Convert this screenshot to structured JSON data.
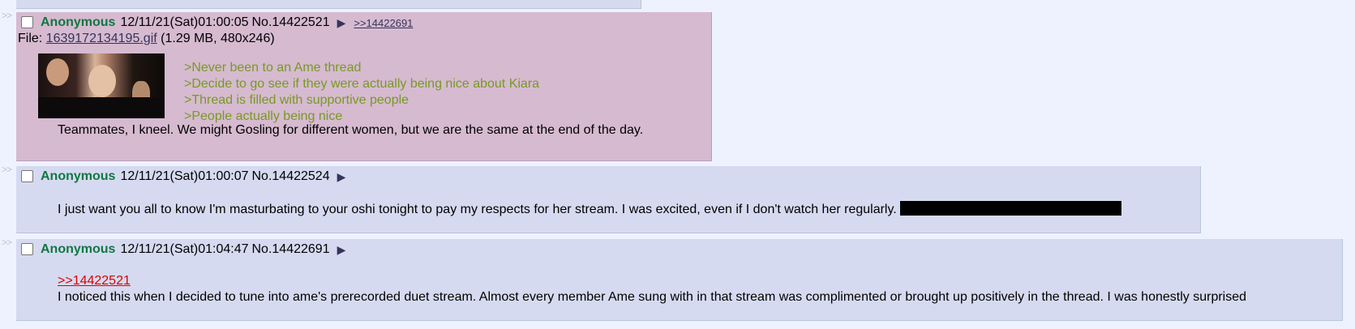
{
  "nav_marker": ">>",
  "posts": [
    {
      "name": "Anonymous",
      "datetime": "12/11/21(Sat)01:00:05",
      "number": "No.14422521",
      "backlinks": [
        ">>14422691"
      ],
      "file": {
        "prefix": "File: ",
        "filename": "1639172134195.gif",
        "info": " (1.29 MB, 480x246)"
      },
      "greentext": [
        ">Never been to an Ame thread",
        ">Decide to go see if they were actually being nice about Kiara",
        ">Thread is filled with supportive people",
        ">People actually being nice"
      ],
      "text": "Teammates, I kneel. We might Gosling for different women, but we are the same at the end of the day."
    },
    {
      "name": "Anonymous",
      "datetime": "12/11/21(Sat)01:00:07",
      "number": "No.14422524",
      "text": "I just want you all to know I'm masturbating to your oshi tonight to pay my respects for her stream. I was excited, even if I don't watch her regularly."
    },
    {
      "name": "Anonymous",
      "datetime": "12/11/21(Sat)01:04:47",
      "number": "No.14422691",
      "quote_ref": ">>14422521",
      "text": "I noticed this when I decided to tune into ame's prerecorded duet stream. Almost every member Ame sung with in that stream was complimented or brought up positively in the thread. I was honestly surprised"
    }
  ],
  "colors": {
    "background": "#eef2ff",
    "reply_bg": "#d6daf0",
    "highlight_bg": "#d6bad0",
    "name": "#117743",
    "greentext": "#789922",
    "quote_link": "#dd0000"
  },
  "icons": [
    "checkbox",
    "post-menu-triangle-icon"
  ]
}
